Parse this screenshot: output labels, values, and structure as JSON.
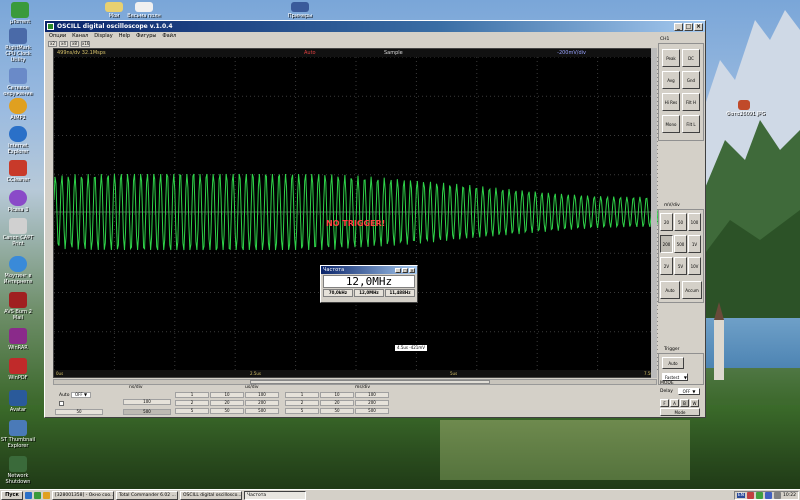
{
  "window": {
    "title": "OSCILL digital oscilloscope v.1.0.4",
    "menu": [
      "Опции",
      "Канал",
      "Display",
      "Help",
      "Фигуры",
      "Файл"
    ],
    "toolbar": [
      "x2",
      "x4",
      "x8",
      "x16"
    ]
  },
  "scope": {
    "timebase": "499ns/dv 32.1Msps",
    "trigger_mode": "Auto",
    "acq_mode": "Sample",
    "scale": "-200mV/div",
    "status": "NO TRIGGER!",
    "cursor_readout": "4.5us  -421mV",
    "x_ticks": [
      "0us",
      "2.5us",
      "5us",
      "7.5us"
    ]
  },
  "frequency_window": {
    "title": "Частота",
    "value": "12,0MHz",
    "buttons": [
      "70,0kHz",
      "12,0MHz",
      "11,488Hz"
    ]
  },
  "right_panel": {
    "ch_label": "CH1",
    "row1": [
      "Peak",
      "DC"
    ],
    "row2": [
      "Avg",
      "Gnd"
    ],
    "row3": [
      "Hi Res",
      "Filt H"
    ],
    "row4": [
      "Mono",
      "Filt L"
    ],
    "mvdiv_label": "mV/div",
    "mv_rows": [
      [
        "20",
        "50",
        "100"
      ],
      [
        "200",
        "500",
        "1V"
      ],
      [
        "2V",
        "5V",
        "10V"
      ]
    ],
    "auto_btns": [
      "Auto",
      "Accum"
    ],
    "trigger_label": "Trigger",
    "trigger_mode": "Auto",
    "trigger_speed": "Fastest",
    "mode_label": "MODE",
    "delay_label": "Delay",
    "delay_value": "OFF",
    "fab": [
      "F",
      "A",
      "B",
      "W"
    ],
    "mode_button": "Mode"
  },
  "bottom": {
    "auto_label": "Auto",
    "auto_value": "OFF",
    "left_cells": [
      [
        "",
        "100",
        ""
      ],
      [
        "50",
        "",
        "500"
      ]
    ],
    "ns_div": "ns/div",
    "us_div": "us/div",
    "ms_div": "ms/div",
    "ns_cells": [
      [
        "1",
        "10",
        "100"
      ],
      [
        "2",
        "20",
        "200"
      ],
      [
        "5",
        "50",
        "500"
      ]
    ],
    "ms_cells": [
      [
        "1",
        "10",
        "100"
      ],
      [
        "2",
        "20",
        "200"
      ],
      [
        "5",
        "50",
        "500"
      ]
    ]
  },
  "desktop_icons": [
    "µTorrent",
    "RightMark CPU Clock Utility",
    "Сетевое окружение",
    "AIMP2",
    "Internet Explorer",
    "CCleaner",
    "Picasa 3",
    "Canon CAPT Print",
    "Моутинг в Интернете",
    "AVS Burn 2 Mail",
    "WinRAR",
    "WinPDF",
    "Avatar",
    "ST Thumbnail Explorer",
    "Network Shutdown",
    "Мои",
    "Весьма полн",
    "Примеры",
    "Фото20091.JPG"
  ],
  "taskbar": {
    "start": "Пуск",
    "tasks": [
      "[328001358] - Окно соо...",
      "Total Commander 6.02 ...",
      "OSCILL digital oscillosco...",
      "Частота"
    ],
    "lang": "EN",
    "time": "10:22"
  },
  "colors": {
    "trace": "#2fd34a",
    "screen": "#000000",
    "titlebar": "#0a246a",
    "no_trigger": "#ff4040"
  }
}
